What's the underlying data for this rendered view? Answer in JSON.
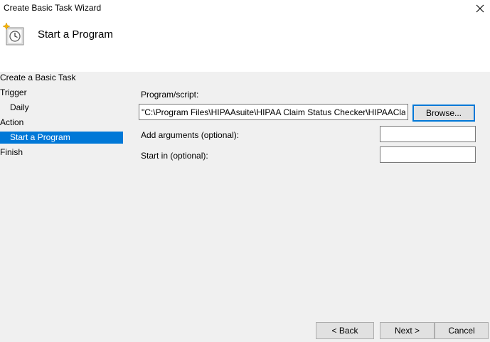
{
  "window": {
    "title": "Create Basic Task Wizard",
    "page_title": "Start a Program"
  },
  "sidebar": {
    "items": [
      {
        "label": "Create a Basic Task"
      },
      {
        "label": "Trigger"
      },
      {
        "label": "Daily"
      },
      {
        "label": "Action"
      },
      {
        "label": "Start a Program"
      },
      {
        "label": "Finish"
      }
    ]
  },
  "form": {
    "program_label": "Program/script:",
    "program_value": "\"C:\\Program Files\\HIPAAsuite\\HIPAA Claim Status Checker\\HIPAAClaimStatusChecker.exe\"",
    "browse_label": "Browse...",
    "arguments_label": "Add arguments (optional):",
    "arguments_value": "",
    "startin_label": "Start in (optional):",
    "startin_value": ""
  },
  "footer": {
    "back_label": "< Back",
    "next_label": "Next >",
    "cancel_label": "Cancel"
  },
  "colors": {
    "selection": "#0078d7",
    "header_bg": "#ffffff",
    "body_bg": "#f0f0f0"
  },
  "icons": [
    "task-scheduler-icon",
    "close-icon"
  ]
}
